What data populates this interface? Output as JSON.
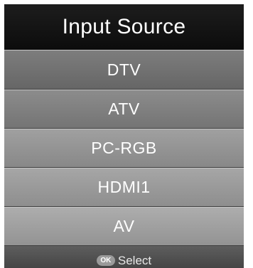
{
  "menu": {
    "title": "Input Source",
    "items": [
      {
        "label": "DTV"
      },
      {
        "label": "ATV"
      },
      {
        "label": "PC-RGB"
      },
      {
        "label": "HDMI1"
      },
      {
        "label": "AV"
      }
    ],
    "footer": {
      "button_icon": "ok-button-icon",
      "button_text": "OK",
      "action_label": "Select"
    }
  }
}
